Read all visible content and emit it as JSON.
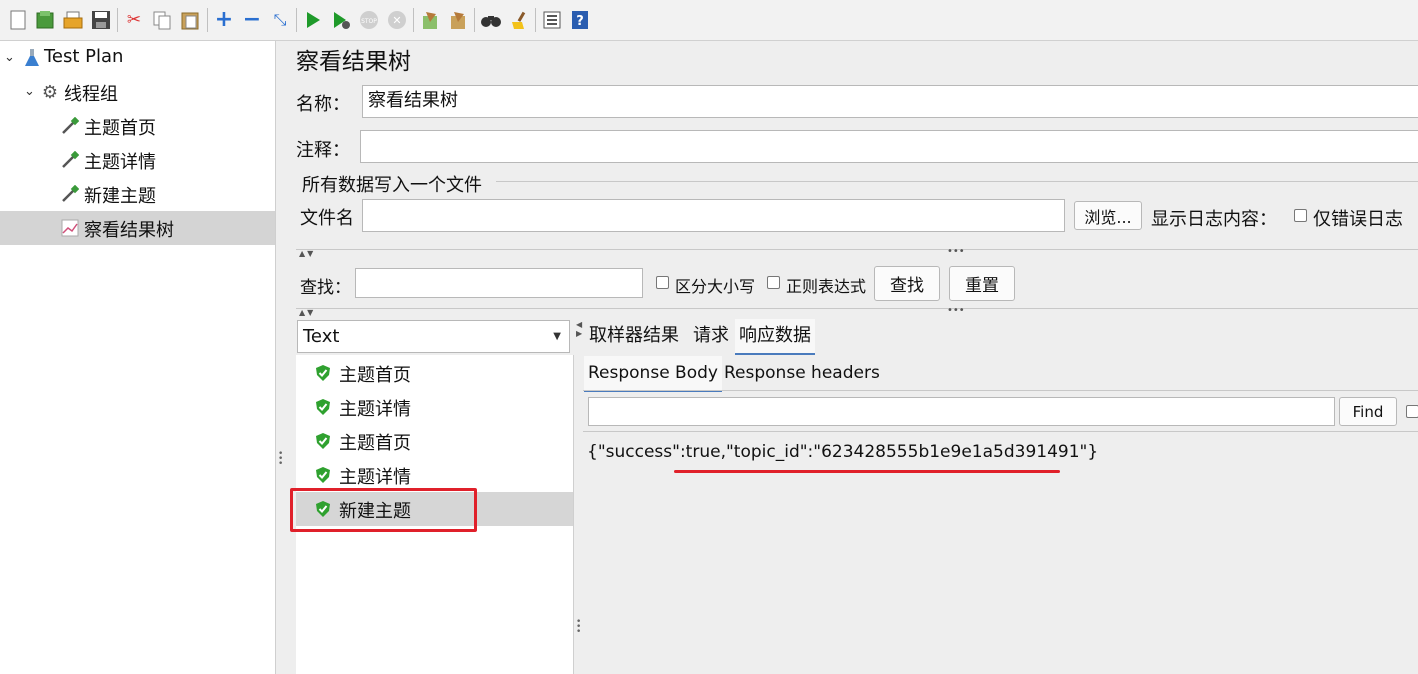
{
  "toolbar": {
    "icons": [
      "new-icon",
      "templates-icon",
      "open-icon",
      "save-icon",
      "cut-icon",
      "copy-icon",
      "paste-icon",
      "expand-icon",
      "collapse-icon",
      "toggle-icon",
      "start-icon",
      "start-no-pause-icon",
      "stop-icon",
      "shutdown-icon",
      "clear-icon",
      "clear-all-icon",
      "search-icon",
      "reset-search-icon",
      "function-helper-icon",
      "help-icon"
    ]
  },
  "tree": {
    "items": [
      {
        "label": "Test Plan",
        "icon": "flask-icon"
      },
      {
        "label": "线程组",
        "icon": "gear-icon"
      },
      {
        "label": "主题首页",
        "icon": "pipette-icon"
      },
      {
        "label": "主题详情",
        "icon": "pipette-icon"
      },
      {
        "label": "新建主题",
        "icon": "pipette-icon"
      },
      {
        "label": "察看结果树",
        "icon": "chart-icon"
      }
    ]
  },
  "panel": {
    "title": "察看结果树",
    "name_label": "名称：",
    "name_value": "察看结果树",
    "comment_label": "注释：",
    "comment_value": "",
    "file_section_label": "所有数据写入一个文件",
    "filename_label": "文件名",
    "filename_value": "",
    "browse_label": "浏览...",
    "log_content_label": "显示日志内容：",
    "errors_only_label": "仅错误日志"
  },
  "search": {
    "label": "查找：",
    "value": "",
    "case_label": "区分大小写",
    "regex_label": "正则表达式",
    "find_label": "查找",
    "reset_label": "重置"
  },
  "results": {
    "renderer": "Text",
    "items": [
      "主题首页",
      "主题详情",
      "主题首页",
      "主题详情",
      "新建主题"
    ],
    "tabs": [
      "取样器结果",
      "请求",
      "响应数据"
    ],
    "subtabs": [
      "Response Body",
      "Response headers"
    ],
    "find_label": "Find",
    "find_value": "",
    "body_text": "{\"success\":true,\"topic_id\":\"623428555b1e9e1a5d391491\"}"
  },
  "colors": {
    "annotation_red": "#e0202a",
    "tab_underline": "#4a7bbd",
    "shield_green": "#2fa12f"
  }
}
